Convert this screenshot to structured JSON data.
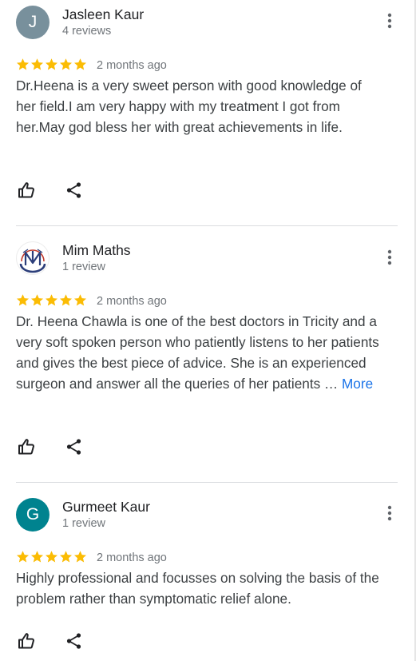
{
  "colors": {
    "star": "#fbbc04",
    "link": "#1a73e8",
    "avatar_j": "#78909c",
    "avatar_g": "#00838f"
  },
  "reviews": [
    {
      "name": "Jasleen Kaur",
      "count": "4 reviews",
      "initial": "J",
      "rating": 5,
      "date": "2 months ago",
      "text": "Dr.Heena is a very sweet person with good knowledge of her field.I am very happy with my treatment I got from her.May god bless her with great achievements in life."
    },
    {
      "name": "Mim Maths",
      "count": "1 review",
      "avatar_icon": "mim-maths-logo",
      "rating": 5,
      "date": "2 months ago",
      "text": "Dr. Heena Chawla is one of the best doctors in Tricity and a very soft spoken person who patiently listens to her patients and gives the best piece of advice. She is an experienced surgeon and answer all the queries of her patients …",
      "more_label": "More"
    },
    {
      "name": "Gurmeet Kaur",
      "count": "1 review",
      "initial": "G",
      "rating": 5,
      "date": "2 months ago",
      "text": "Highly professional and focusses on solving the basis of the problem rather than symptomatic relief alone."
    }
  ],
  "icons": {
    "menu": "more-vert-icon",
    "like": "thumb-up-icon",
    "share": "share-icon",
    "star": "star-icon"
  }
}
